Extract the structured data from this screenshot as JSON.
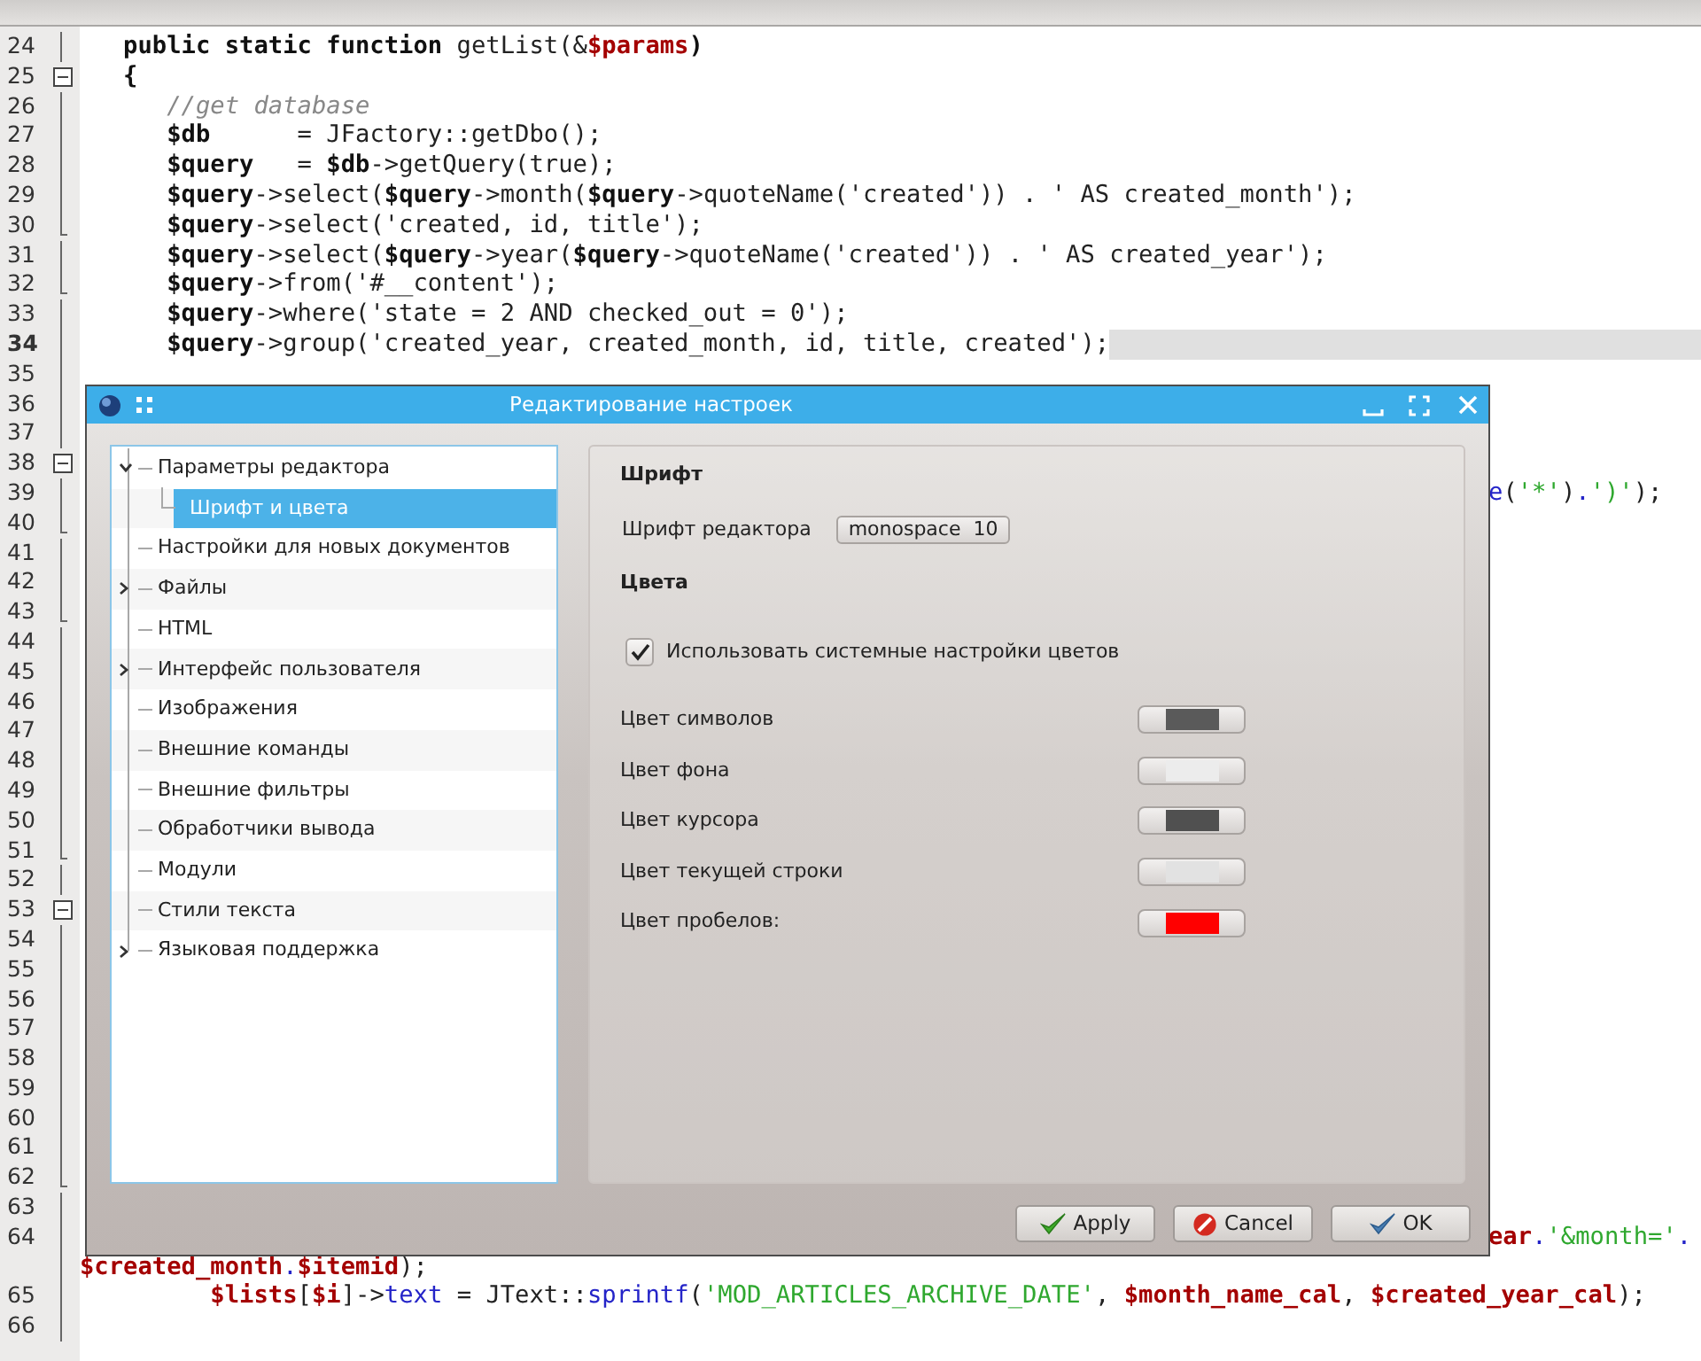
{
  "editor": {
    "lines": [
      {
        "number": "24",
        "fold": {
          "kind": "line"
        },
        "kind": "code",
        "current": false,
        "segments": [
          {
            "text": "   public static function",
            "kind": "kw"
          },
          {
            "text": " getList(&",
            "kind": "plain"
          },
          {
            "text": "$params",
            "kind": "var"
          },
          {
            "text": ")",
            "kind": "kw"
          }
        ]
      },
      {
        "number": "25",
        "fold": {
          "kind": "box"
        },
        "kind": "code",
        "current": false,
        "segments": [
          {
            "text": "   {",
            "kind": "kw"
          }
        ]
      },
      {
        "number": "26",
        "fold": {
          "kind": "line"
        },
        "kind": "code",
        "current": false,
        "segments": [
          {
            "text": "      //get database",
            "kind": "comment"
          }
        ]
      },
      {
        "number": "27",
        "fold": {
          "kind": "line"
        },
        "kind": "code",
        "current": false,
        "segments": [
          {
            "text": "      $db",
            "kind": "kw"
          },
          {
            "text": "      = JFactory::getDbo();",
            "kind": "plain"
          }
        ]
      },
      {
        "number": "28",
        "fold": {
          "kind": "line"
        },
        "kind": "code",
        "current": false,
        "segments": [
          {
            "text": "      $query",
            "kind": "kw"
          },
          {
            "text": "   = ",
            "kind": "plain"
          },
          {
            "text": "$db",
            "kind": "kw"
          },
          {
            "text": "->getQuery(true);",
            "kind": "plain"
          }
        ]
      },
      {
        "number": "29",
        "fold": {
          "kind": "line"
        },
        "kind": "code",
        "current": false,
        "segments": [
          {
            "text": "      $query",
            "kind": "kw"
          },
          {
            "text": "->select(",
            "kind": "plain"
          },
          {
            "text": "$query",
            "kind": "kw"
          },
          {
            "text": "->month(",
            "kind": "plain"
          },
          {
            "text": "$query",
            "kind": "kw"
          },
          {
            "text": "->quoteName('created')) . ' AS created_month');",
            "kind": "plain"
          }
        ]
      },
      {
        "number": "30",
        "fold": {
          "kind": "end"
        },
        "kind": "code",
        "current": false,
        "segments": [
          {
            "text": "      $query",
            "kind": "kw"
          },
          {
            "text": "->select('created, id, title');",
            "kind": "plain"
          }
        ]
      },
      {
        "number": "31",
        "fold": {
          "kind": "line"
        },
        "kind": "code",
        "current": false,
        "segments": [
          {
            "text": "      $query",
            "kind": "kw"
          },
          {
            "text": "->select(",
            "kind": "plain"
          },
          {
            "text": "$query",
            "kind": "kw"
          },
          {
            "text": "->year(",
            "kind": "plain"
          },
          {
            "text": "$query",
            "kind": "kw"
          },
          {
            "text": "->quoteName('created')) . ' AS created_year');",
            "kind": "plain"
          }
        ]
      },
      {
        "number": "32",
        "fold": {
          "kind": "end"
        },
        "kind": "code",
        "current": false,
        "segments": [
          {
            "text": "      $query",
            "kind": "kw"
          },
          {
            "text": "->from('#__content');",
            "kind": "plain"
          }
        ]
      },
      {
        "number": "33",
        "fold": {
          "kind": "line"
        },
        "kind": "code",
        "current": false,
        "segments": [
          {
            "text": "      $query",
            "kind": "kw"
          },
          {
            "text": "->where('state = 2 AND checked_out = 0');",
            "kind": "plain"
          }
        ]
      },
      {
        "number": "34",
        "fold": {
          "kind": "line"
        },
        "kind": "code",
        "current": true,
        "segments": [
          {
            "text": "      $query",
            "kind": "kw"
          },
          {
            "text": "->group('created_year, created_month, id, title, created');",
            "kind": "plain"
          }
        ]
      },
      {
        "number": "35",
        "fold": {
          "kind": "line"
        },
        "current": false
      },
      {
        "number": "36",
        "fold": {
          "kind": "line"
        },
        "current": false
      },
      {
        "number": "37",
        "fold": {
          "kind": "line"
        },
        "current": false
      },
      {
        "number": "38",
        "fold": {
          "kind": "box"
        },
        "current": false
      },
      {
        "number": "39",
        "fold": {
          "kind": "line"
        },
        "kind": "tail",
        "current": false,
        "segments": [
          {
            "text": "e",
            "kind": "method"
          },
          {
            "text": "(",
            "kind": "plain"
          },
          {
            "text": "'*'",
            "kind": "str"
          },
          {
            "text": ")",
            "kind": "plain"
          },
          {
            "text": ".",
            "kind": "method"
          },
          {
            "text": "')'",
            "kind": "str"
          },
          {
            "text": ");",
            "kind": "plain"
          }
        ]
      },
      {
        "number": "40",
        "fold": {
          "kind": "end"
        },
        "current": false
      },
      {
        "number": "41",
        "fold": {
          "kind": "line"
        },
        "current": false
      },
      {
        "number": "42",
        "fold": {
          "kind": "line"
        },
        "current": false
      },
      {
        "number": "43",
        "fold": {
          "kind": "end"
        },
        "current": false
      },
      {
        "number": "44",
        "fold": {
          "kind": "line"
        },
        "current": false
      },
      {
        "number": "45",
        "fold": {
          "kind": "line"
        },
        "current": false
      },
      {
        "number": "46",
        "fold": {
          "kind": "line"
        },
        "current": false
      },
      {
        "number": "47",
        "fold": {
          "kind": "line"
        },
        "current": false
      },
      {
        "number": "48",
        "fold": {
          "kind": "line"
        },
        "current": false
      },
      {
        "number": "49",
        "fold": {
          "kind": "line"
        },
        "current": false
      },
      {
        "number": "50",
        "fold": {
          "kind": "line"
        },
        "current": false
      },
      {
        "number": "51",
        "fold": {
          "kind": "end"
        },
        "current": false
      },
      {
        "number": "52",
        "fold": {
          "kind": "line"
        },
        "current": false
      },
      {
        "number": "53",
        "fold": {
          "kind": "box"
        },
        "current": false
      },
      {
        "number": "54",
        "fold": {
          "kind": "line"
        },
        "current": false
      },
      {
        "number": "55",
        "fold": {
          "kind": "line"
        },
        "current": false
      },
      {
        "number": "56",
        "fold": {
          "kind": "line"
        },
        "current": false
      },
      {
        "number": "57",
        "fold": {
          "kind": "line"
        },
        "current": false
      },
      {
        "number": "58",
        "fold": {
          "kind": "line"
        },
        "current": false
      },
      {
        "number": "59",
        "fold": {
          "kind": "line"
        },
        "current": false
      },
      {
        "number": "60",
        "fold": {
          "kind": "line"
        },
        "current": false
      },
      {
        "number": "61",
        "fold": {
          "kind": "line"
        },
        "current": false
      },
      {
        "number": "62",
        "fold": {
          "kind": "end"
        },
        "current": false
      },
      {
        "number": "63",
        "fold": {
          "kind": "line"
        },
        "current": false
      },
      {
        "number": "64",
        "fold": {
          "kind": "line"
        },
        "kind": "tail",
        "current": false,
        "segments": [
          {
            "text": "ear",
            "kind": "var"
          },
          {
            "text": ".",
            "kind": "method"
          },
          {
            "text": "'&month='",
            "kind": "str"
          },
          {
            "text": ".",
            "kind": "method"
          }
        ]
      },
      {
        "fold": {
          "kind": "line"
        },
        "kind": "code",
        "current": false,
        "segments": [
          {
            "text": "$created_month",
            "kind": "var"
          },
          {
            "text": ".",
            "kind": "method"
          },
          {
            "text": "$itemid",
            "kind": "var"
          },
          {
            "text": ");",
            "kind": "plain"
          }
        ]
      },
      {
        "number": "65",
        "fold": {
          "kind": "line"
        },
        "kind": "code",
        "current": false,
        "segments": [
          {
            "text": "         $lists",
            "kind": "var"
          },
          {
            "text": "[",
            "kind": "plain"
          },
          {
            "text": "$i",
            "kind": "var"
          },
          {
            "text": "]->",
            "kind": "plain"
          },
          {
            "text": "text",
            "kind": "method"
          },
          {
            "text": " = JText::",
            "kind": "plain"
          },
          {
            "text": "sprintf",
            "kind": "method"
          },
          {
            "text": "(",
            "kind": "plain"
          },
          {
            "text": "'MOD_ARTICLES_ARCHIVE_DATE'",
            "kind": "str"
          },
          {
            "text": ", ",
            "kind": "plain"
          },
          {
            "text": "$month_name_cal",
            "kind": "var"
          },
          {
            "text": ", ",
            "kind": "plain"
          },
          {
            "text": "$created_year_cal",
            "kind": "var"
          },
          {
            "text": ");",
            "kind": "plain"
          }
        ]
      },
      {
        "number": "66",
        "fold": {
          "kind": "line"
        },
        "current": false
      }
    ]
  },
  "dialog": {
    "title": "Редактирование настроек",
    "tree": [
      {
        "label": "Параметры редактора",
        "expanded": true,
        "selected": false,
        "children": [
          {
            "label": "Шрифт и цвета",
            "selected": true
          }
        ]
      },
      {
        "label": "Настройки для новых документов",
        "selected": false
      },
      {
        "label": "Файлы",
        "expanded": false,
        "selected": false
      },
      {
        "label": "HTML",
        "selected": false
      },
      {
        "label": "Интерфейс пользователя",
        "expanded": false,
        "selected": false
      },
      {
        "label": "Изображения",
        "selected": false
      },
      {
        "label": "Внешние команды",
        "selected": false
      },
      {
        "label": "Внешние фильтры",
        "selected": false
      },
      {
        "label": "Обработчики вывода",
        "selected": false
      },
      {
        "label": "Модули",
        "selected": false
      },
      {
        "label": "Стили текста",
        "selected": false
      },
      {
        "label": "Языковая поддержка",
        "expanded": false,
        "selected": false
      }
    ],
    "panel": {
      "font_heading": "Шрифт",
      "font_label": "Шрифт редактора",
      "font_button": "monospace  10",
      "colors_heading": "Цвета",
      "system_colors": {
        "label": "Использовать системные настройки цветов",
        "checked": true
      },
      "color_rows": [
        {
          "label": "Цвет символов",
          "color": "#5a5a5a"
        },
        {
          "label": "Цвет фона",
          "color": "#ececec"
        },
        {
          "label": "Цвет курсора",
          "color": "#505050"
        },
        {
          "label": "Цвет текущей строки",
          "color": "#e2e2e2"
        },
        {
          "label": "Цвет пробелов:",
          "color": "#ff0000"
        }
      ]
    },
    "buttons": [
      {
        "label": "Apply",
        "kind": "apply"
      },
      {
        "label": "Cancel",
        "kind": "cancel"
      },
      {
        "label": "OK",
        "kind": "ok"
      }
    ]
  }
}
